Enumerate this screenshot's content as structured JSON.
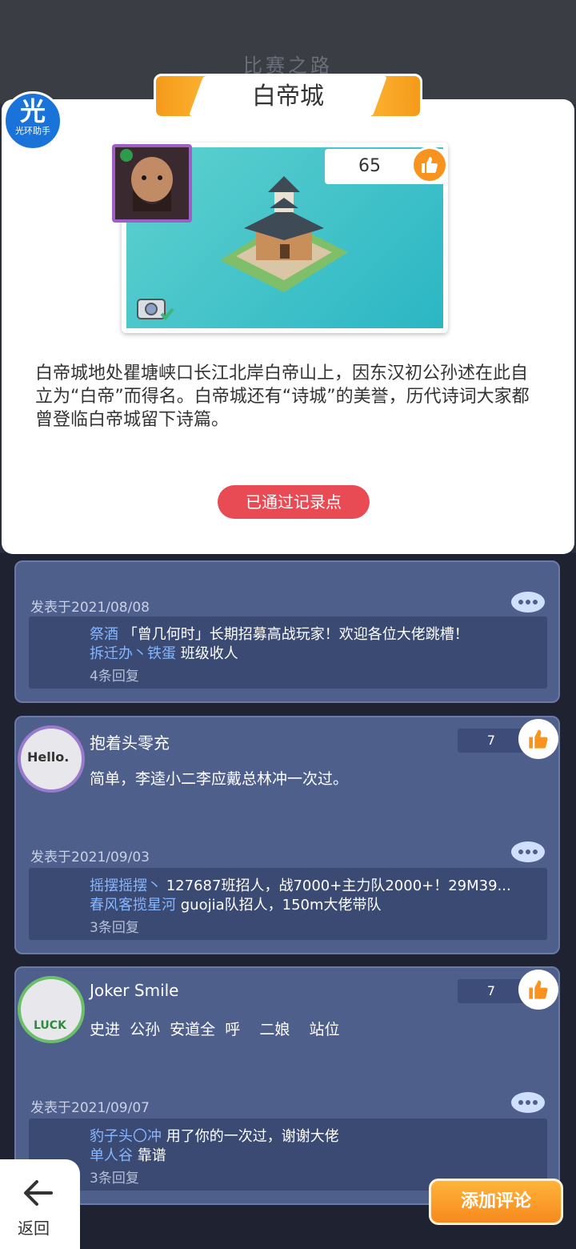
{
  "background": {
    "title": "比赛之路"
  },
  "logo": {
    "big": "光",
    "small": "光环助手"
  },
  "location": {
    "title": "白帝城",
    "like_count": "65",
    "description": "白帝城地处瞿塘峡口长江北岸白帝山上，因东汉初公孙述在此自立为“白帝”而得名。白帝城还有“诗城”的美誉，历代诗词大家都曾登临白帝城留下诗篇。",
    "status_button": "已通过记录点"
  },
  "comments": [
    {
      "date": "发表于2021/08/08",
      "replies": [
        {
          "name": "祭酒",
          "text": "「曾几何时」长期招募高战玩家！欢迎各位大佬跳槽！"
        },
        {
          "name": "拆迁办丶铁蛋",
          "text": "班级收人"
        }
      ],
      "reply_count": "4条回复"
    },
    {
      "name": "抱着头零充",
      "avatar_label": "Hello.",
      "likes": "7",
      "text": "简单，李逵小二李应戴总林冲一次过。",
      "date": "发表于2021/09/03",
      "replies": [
        {
          "name": "摇摆摇摆丶",
          "text": "127687班招人，战7000+主力队2000+！29M39..."
        },
        {
          "name": "春风客揽星河",
          "text": "guojia队招人，150m大佬带队"
        }
      ],
      "reply_count": "3条回复"
    },
    {
      "name": "Joker Smile",
      "avatar_label": "LUCK",
      "likes": "7",
      "text": "史进  公孙  安道全  呼    二娘    站位",
      "date": "发表于2021/09/07",
      "replies": [
        {
          "name": "豹子头〇冲",
          "text": "用了你的一次过，谢谢大佬"
        },
        {
          "name": "单人谷",
          "text": "靠谱"
        }
      ],
      "reply_count": "3条回复"
    }
  ],
  "footer": {
    "back_label": "返回",
    "add_comment": "添加评论"
  },
  "colors": {
    "accent": "#f7931e",
    "status_red": "#e94b54",
    "card_blue": "#4f5f8c",
    "reply_name": "#86b6ff"
  }
}
